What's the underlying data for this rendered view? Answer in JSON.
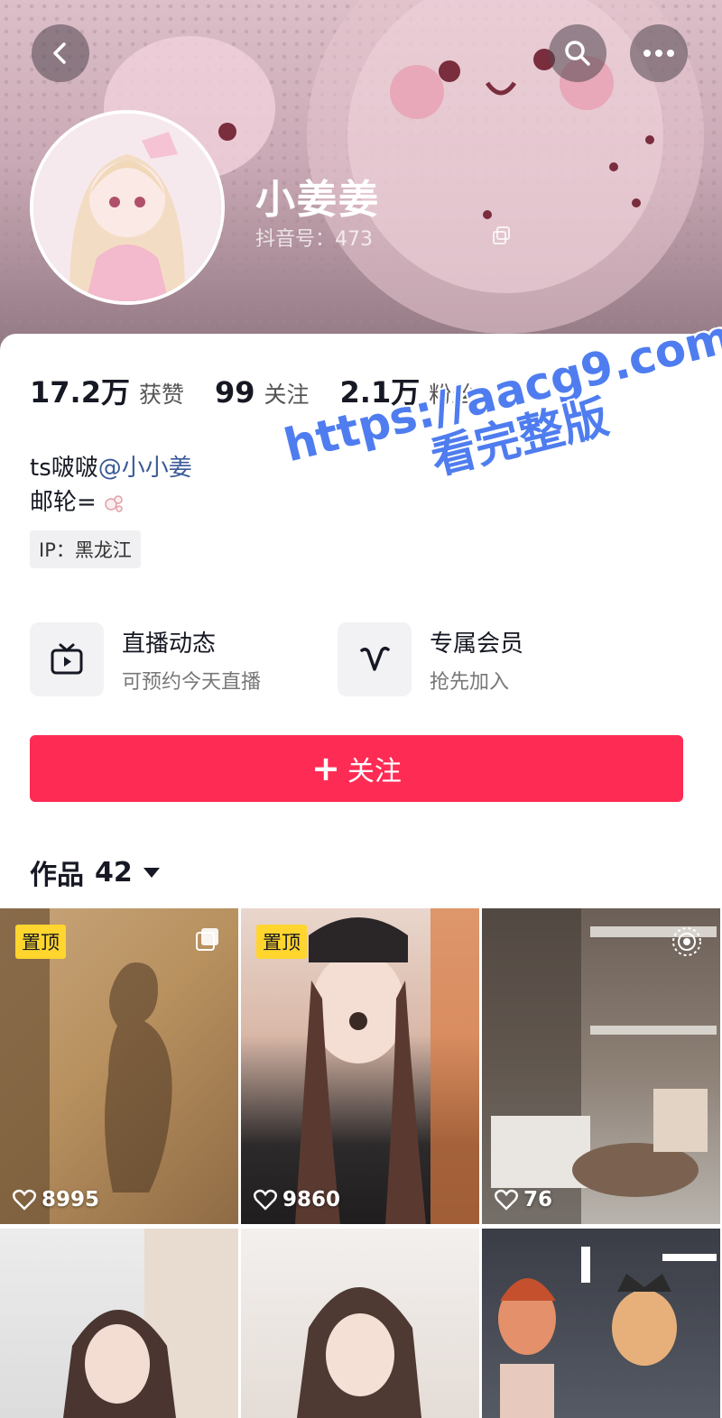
{
  "profile": {
    "nickname": "小姜姜",
    "douyin_id": "抖音号：473",
    "stats": [
      {
        "value": "17.2万",
        "label": "获赞"
      },
      {
        "value": "99",
        "label": "关注"
      },
      {
        "value": "2.1万",
        "label": "粉丝"
      }
    ],
    "bio_prefix": "ts啵啵",
    "bio_mention": "@小小姜",
    "bio_line2": "邮轮=",
    "ip": "IP：黑龙江"
  },
  "features": [
    {
      "title": "直播动态",
      "subtitle": "可预约今天直播",
      "icon": "tv-icon"
    },
    {
      "title": "专属会员",
      "subtitle": "抢先加入",
      "icon": "v-icon"
    }
  ],
  "follow_button": {
    "plus": "+",
    "label": "关注"
  },
  "works_tab": {
    "label": "作品",
    "count": "42"
  },
  "videos": [
    {
      "pinned": "置顶",
      "likes": "8995"
    },
    {
      "pinned": "置顶",
      "likes": "9860"
    },
    {
      "pinned": "",
      "likes": "76"
    },
    {
      "pinned": "",
      "likes": ""
    },
    {
      "pinned": "",
      "likes": ""
    },
    {
      "pinned": "",
      "likes": ""
    }
  ],
  "watermark": {
    "line1": "https://aacg9.com",
    "line2": "看完整版"
  },
  "colors": {
    "accent": "#fe2c55",
    "pin": "#ffd52e",
    "mention": "#3b5998",
    "watermark": "#4f7df0"
  }
}
